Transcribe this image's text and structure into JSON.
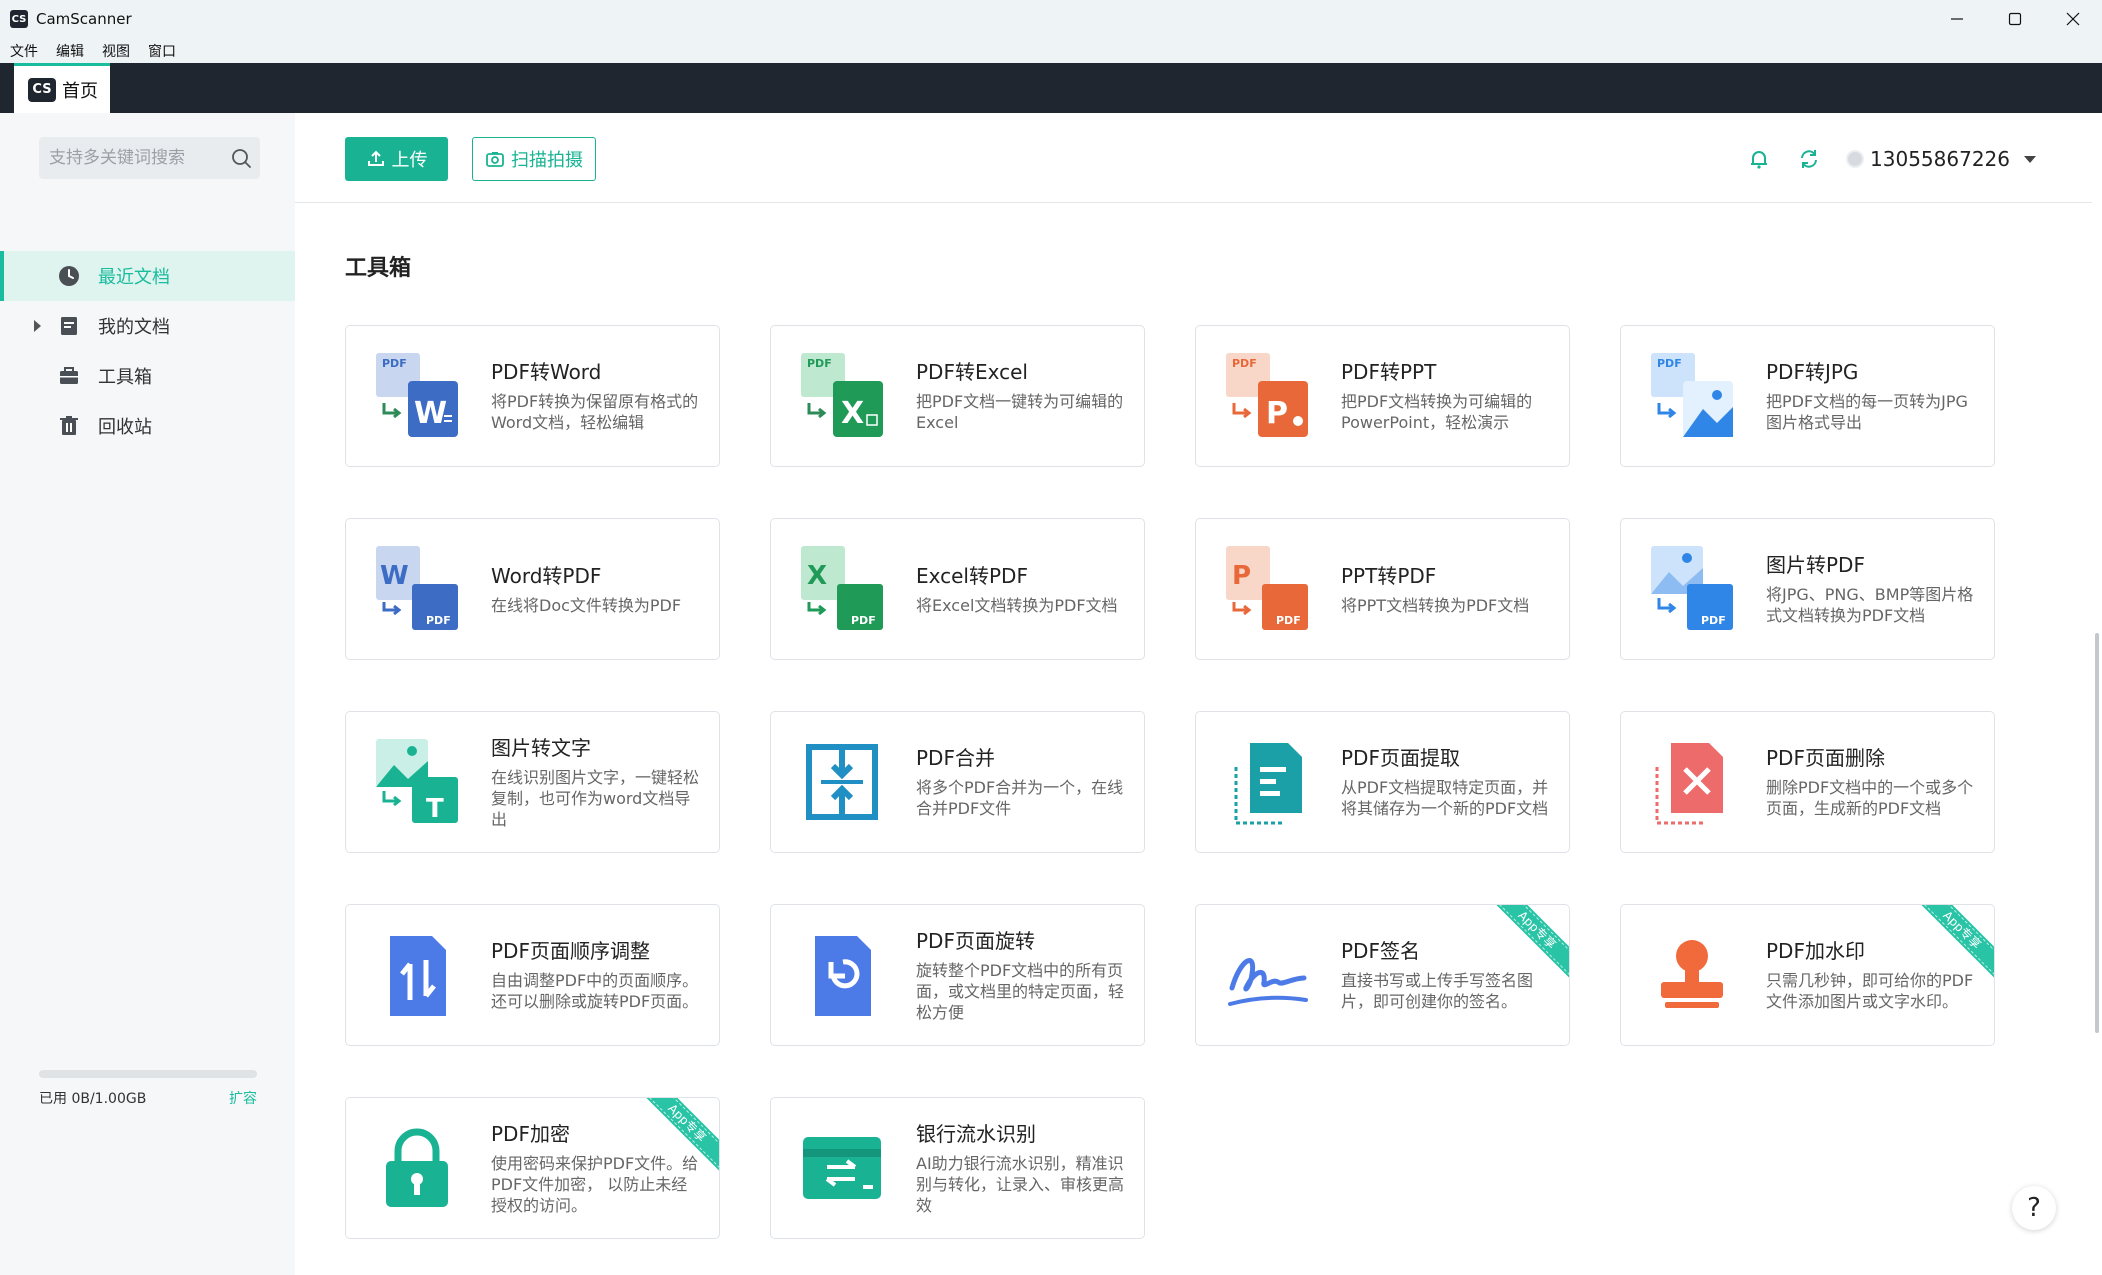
{
  "window": {
    "logo_text": "CS",
    "title": "CamScanner"
  },
  "menubar": [
    "文件",
    "编辑",
    "视图",
    "窗口"
  ],
  "tab": {
    "logo_text": "CS",
    "label": "首页"
  },
  "sidebar": {
    "search_placeholder": "支持多关键词搜索",
    "items": [
      {
        "label": "最近文档",
        "icon": "clock-icon",
        "active": true
      },
      {
        "label": "我的文档",
        "icon": "document-icon",
        "expandable": true
      },
      {
        "label": "工具箱",
        "icon": "toolbox-icon"
      },
      {
        "label": "回收站",
        "icon": "trash-icon"
      }
    ],
    "storage": {
      "used_label": "已用 0B/1.00GB",
      "used_fraction": 0.0,
      "expand_label": "扩容"
    }
  },
  "toolbar": {
    "upload_label": "上传",
    "scan_label": "扫描拍摄",
    "account": "13055867226"
  },
  "toolbox": {
    "title": "工具箱",
    "ribbon_label": "App专享",
    "cards": [
      {
        "title": "PDF转Word",
        "desc": "将PDF转换为保留原有格式的Word文档，轻松编辑",
        "icon": "pdf-to-word-icon"
      },
      {
        "title": "PDF转Excel",
        "desc": "把PDF文档一键转为可编辑的Excel",
        "icon": "pdf-to-excel-icon"
      },
      {
        "title": "PDF转PPT",
        "desc": "把PDF文档转换为可编辑的PowerPoint，轻松演示",
        "icon": "pdf-to-ppt-icon"
      },
      {
        "title": "PDF转JPG",
        "desc": "把PDF文档的每一页转为JPG图片格式导出",
        "icon": "pdf-to-jpg-icon"
      },
      {
        "title": "Word转PDF",
        "desc": "在线将Doc文件转换为PDF",
        "icon": "word-to-pdf-icon"
      },
      {
        "title": "Excel转PDF",
        "desc": "将Excel文档转换为PDF文档",
        "icon": "excel-to-pdf-icon"
      },
      {
        "title": "PPT转PDF",
        "desc": "将PPT文档转换为PDF文档",
        "icon": "ppt-to-pdf-icon"
      },
      {
        "title": "图片转PDF",
        "desc": "将JPG、PNG、BMP等图片格式文档转换为PDF文档",
        "icon": "image-to-pdf-icon"
      },
      {
        "title": "图片转文字",
        "desc": "在线识别图片文字，一键轻松复制，也可作为word文档导出",
        "icon": "image-to-text-icon"
      },
      {
        "title": "PDF合并",
        "desc": "将多个PDF合并为一个，在线合并PDF文件",
        "icon": "pdf-merge-icon"
      },
      {
        "title": "PDF页面提取",
        "desc": "从PDF文档提取特定页面，并将其储存为一个新的PDF文档",
        "icon": "pdf-extract-icon"
      },
      {
        "title": "PDF页面删除",
        "desc": "删除PDF文档中的一个或多个页面，生成新的PDF文档",
        "icon": "pdf-delete-icon"
      },
      {
        "title": "PDF页面顺序调整",
        "desc": "自由调整PDF中的页面顺序。还可以删除或旋转PDF页面。",
        "icon": "pdf-reorder-icon"
      },
      {
        "title": "PDF页面旋转",
        "desc": "旋转整个PDF文档中的所有页面，或文档里的特定页面，轻松方便",
        "icon": "pdf-rotate-icon"
      },
      {
        "title": "PDF签名",
        "desc": "直接书写或上传手写签名图片，即可创建你的签名。",
        "icon": "signature-icon",
        "app_only": true
      },
      {
        "title": "PDF加水印",
        "desc": "只需几秒钟，即可给你的PDF文件添加图片或文字水印。",
        "icon": "stamp-icon",
        "app_only": true
      },
      {
        "title": "PDF加密",
        "desc": "使用密码来保护PDF文件。给PDF文件加密， 以防止未经授权的访问。",
        "icon": "lock-icon",
        "app_only": true
      },
      {
        "title": "银行流水识别",
        "desc": "AI助力银行流水识别，精准识别与转化，让录入、审核更高效",
        "icon": "bank-statement-icon"
      }
    ]
  },
  "help_label": "?",
  "colors": {
    "accent": "#19b394",
    "dark_bar": "#1f2630"
  }
}
